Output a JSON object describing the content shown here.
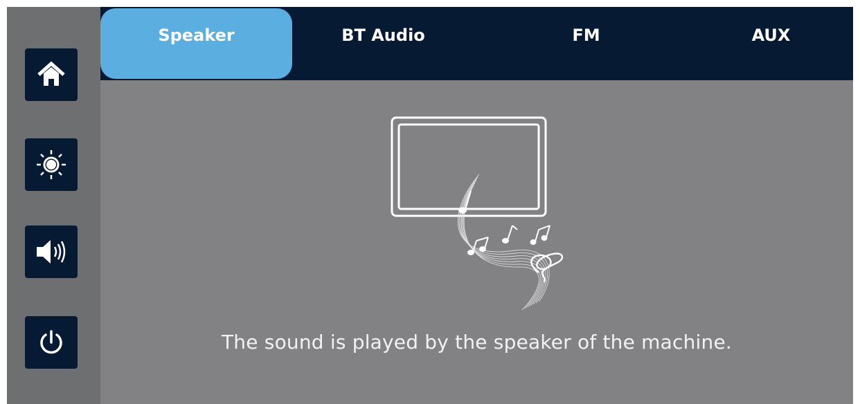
{
  "tabs": [
    {
      "label": "Speaker",
      "active": true
    },
    {
      "label": "BT Audio",
      "active": false
    },
    {
      "label": "FM",
      "active": false
    },
    {
      "label": "AUX",
      "active": false
    }
  ],
  "sidebar": {
    "items": [
      {
        "icon": "home-icon"
      },
      {
        "icon": "brightness-icon"
      },
      {
        "icon": "volume-icon"
      },
      {
        "icon": "power-icon"
      }
    ]
  },
  "main": {
    "caption": "The sound is played by the speaker of the machine."
  },
  "colors": {
    "nav_bg": "#071a33",
    "active_tab": "#5aaee0",
    "content_bg": "#828285",
    "sidebar_bg": "#6e6f71"
  }
}
